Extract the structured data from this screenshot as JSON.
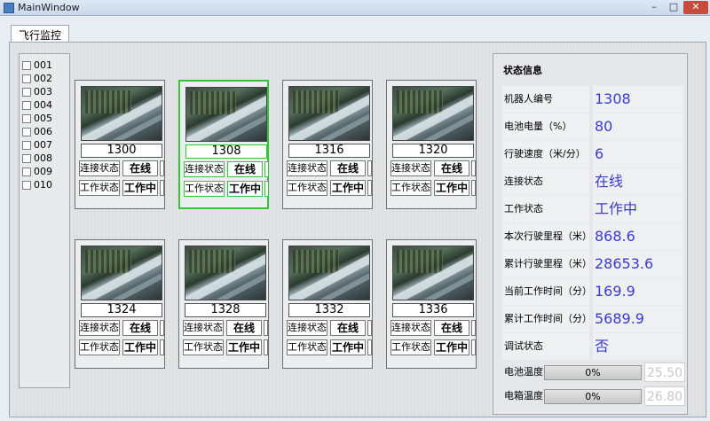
{
  "window": {
    "title": "MainWindow",
    "min_glyph": "–",
    "max_glyph": "□",
    "close_glyph": "✕"
  },
  "tabs": [
    {
      "label": "飞行监控"
    }
  ],
  "robot_list": [
    {
      "label": "001",
      "checked": false
    },
    {
      "label": "002",
      "checked": false
    },
    {
      "label": "003",
      "checked": false
    },
    {
      "label": "004",
      "checked": false
    },
    {
      "label": "005",
      "checked": false
    },
    {
      "label": "006",
      "checked": false
    },
    {
      "label": "007",
      "checked": false
    },
    {
      "label": "008",
      "checked": false
    },
    {
      "label": "009",
      "checked": false
    },
    {
      "label": "010",
      "checked": false
    }
  ],
  "cards": [
    {
      "id": "1300",
      "conn_label": "连接状态",
      "conn_value": "在线",
      "work_label": "工作状态",
      "work_value": "工作中",
      "selected": false
    },
    {
      "id": "1308",
      "conn_label": "连接状态",
      "conn_value": "在线",
      "work_label": "工作状态",
      "work_value": "工作中",
      "selected": true
    },
    {
      "id": "1316",
      "conn_label": "连接状态",
      "conn_value": "在线",
      "work_label": "工作状态",
      "work_value": "工作中",
      "selected": false
    },
    {
      "id": "1320",
      "conn_label": "连接状态",
      "conn_value": "在线",
      "work_label": "工作状态",
      "work_value": "工作中",
      "selected": false
    },
    {
      "id": "1324",
      "conn_label": "连接状态",
      "conn_value": "在线",
      "work_label": "工作状态",
      "work_value": "工作中",
      "selected": false
    },
    {
      "id": "1328",
      "conn_label": "连接状态",
      "conn_value": "在线",
      "work_label": "工作状态",
      "work_value": "工作中",
      "selected": false
    },
    {
      "id": "1332",
      "conn_label": "连接状态",
      "conn_value": "在线",
      "work_label": "工作状态",
      "work_value": "工作中",
      "selected": false
    },
    {
      "id": "1336",
      "conn_label": "连接状态",
      "conn_value": "在线",
      "work_label": "工作状态",
      "work_value": "工作中",
      "selected": false
    }
  ],
  "status_panel": {
    "title": "状态信息",
    "rows": [
      {
        "label": "机器人编号",
        "value": "1308"
      },
      {
        "label": "电池电量（%）",
        "value": "80"
      },
      {
        "label": "行驶速度（米/分）",
        "value": "6"
      },
      {
        "label": "连接状态",
        "value": "在线"
      },
      {
        "label": "工作状态",
        "value": "工作中"
      },
      {
        "label": "本次行驶里程（米）",
        "value": "868.6"
      },
      {
        "label": "累计行驶里程（米）",
        "value": "28653.6"
      },
      {
        "label": "当前工作时间（分）",
        "value": "169.9"
      },
      {
        "label": "累计工作时间（分）",
        "value": "5689.9"
      },
      {
        "label": "调试状态",
        "value": "否"
      }
    ],
    "battery_temp": {
      "label": "电池温度",
      "progress": "0%",
      "value": "25.50"
    },
    "cabinet_temp": {
      "label": "电箱温度",
      "progress": "0%",
      "value": "26.80"
    }
  },
  "colors": {
    "value_text": "#3a3ad0",
    "selected_border": "#38c23a",
    "close_button": "#c74a3a"
  }
}
